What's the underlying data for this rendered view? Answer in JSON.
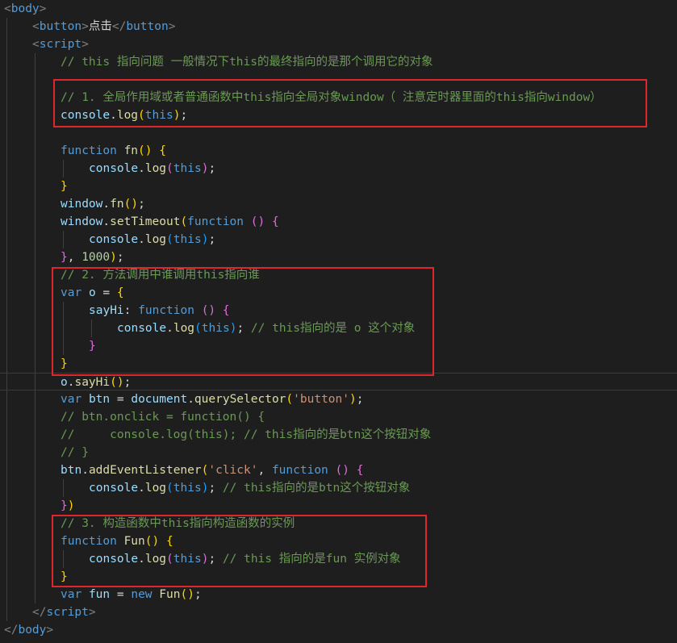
{
  "colors": {
    "background": "#1e1e1e",
    "tag_bracket": "#808080",
    "tag_name": "#569cd6",
    "keyword": "#569cd6",
    "function_name": "#dcdcaa",
    "identifier": "#9cdcfe",
    "string": "#ce9178",
    "number": "#b5cea8",
    "comment": "#6a9955",
    "text": "#d4d4d4",
    "bracket_gold": "#ffd700",
    "bracket_pink": "#da70d6",
    "bracket_blue": "#179fff",
    "highlight_box": "#e0262d"
  },
  "lines": [
    {
      "indent": 0,
      "tokens": [
        {
          "t": "<",
          "c": "tag_bracket"
        },
        {
          "t": "body",
          "c": "tag_name"
        },
        {
          "t": ">",
          "c": "tag_bracket"
        }
      ]
    },
    {
      "indent": 1,
      "tokens": [
        {
          "t": "<",
          "c": "tag_bracket"
        },
        {
          "t": "button",
          "c": "tag_name"
        },
        {
          "t": ">",
          "c": "tag_bracket"
        },
        {
          "t": "点击",
          "c": "text"
        },
        {
          "t": "</",
          "c": "tag_bracket"
        },
        {
          "t": "button",
          "c": "tag_name"
        },
        {
          "t": ">",
          "c": "tag_bracket"
        }
      ]
    },
    {
      "indent": 1,
      "tokens": [
        {
          "t": "<",
          "c": "tag_bracket"
        },
        {
          "t": "script",
          "c": "tag_name"
        },
        {
          "t": ">",
          "c": "tag_bracket"
        }
      ]
    },
    {
      "indent": 2,
      "tokens": [
        {
          "t": "// this 指向问题 一般情况下this的最终指向的是那个调用它的对象",
          "c": "comment"
        }
      ]
    },
    {
      "indent": 0,
      "tokens": []
    },
    {
      "indent": 2,
      "tokens": [
        {
          "t": "// 1. 全局作用域或者普通函数中this指向全局对象window（ 注意定时器里面的this指向window）",
          "c": "comment"
        }
      ]
    },
    {
      "indent": 2,
      "tokens": [
        {
          "t": "console",
          "c": "identifier"
        },
        {
          "t": ".",
          "c": "text"
        },
        {
          "t": "log",
          "c": "function_name"
        },
        {
          "t": "(",
          "c": "bracket_gold"
        },
        {
          "t": "this",
          "c": "keyword"
        },
        {
          "t": ")",
          "c": "bracket_gold"
        },
        {
          "t": ";",
          "c": "text"
        }
      ]
    },
    {
      "indent": 0,
      "tokens": []
    },
    {
      "indent": 2,
      "tokens": [
        {
          "t": "function",
          "c": "keyword"
        },
        {
          "t": " ",
          "c": "text"
        },
        {
          "t": "fn",
          "c": "function_name"
        },
        {
          "t": "()",
          "c": "bracket_gold"
        },
        {
          "t": " ",
          "c": "text"
        },
        {
          "t": "{",
          "c": "bracket_gold"
        }
      ]
    },
    {
      "indent": 3,
      "tokens": [
        {
          "t": "console",
          "c": "identifier"
        },
        {
          "t": ".",
          "c": "text"
        },
        {
          "t": "log",
          "c": "function_name"
        },
        {
          "t": "(",
          "c": "bracket_pink"
        },
        {
          "t": "this",
          "c": "keyword"
        },
        {
          "t": ")",
          "c": "bracket_pink"
        },
        {
          "t": ";",
          "c": "text"
        }
      ]
    },
    {
      "indent": 2,
      "tokens": [
        {
          "t": "}",
          "c": "bracket_gold"
        }
      ]
    },
    {
      "indent": 2,
      "tokens": [
        {
          "t": "window",
          "c": "identifier"
        },
        {
          "t": ".",
          "c": "text"
        },
        {
          "t": "fn",
          "c": "function_name"
        },
        {
          "t": "()",
          "c": "bracket_gold"
        },
        {
          "t": ";",
          "c": "text"
        }
      ]
    },
    {
      "indent": 2,
      "tokens": [
        {
          "t": "window",
          "c": "identifier"
        },
        {
          "t": ".",
          "c": "text"
        },
        {
          "t": "setTimeout",
          "c": "function_name"
        },
        {
          "t": "(",
          "c": "bracket_gold"
        },
        {
          "t": "function",
          "c": "keyword"
        },
        {
          "t": " ",
          "c": "text"
        },
        {
          "t": "()",
          "c": "bracket_pink"
        },
        {
          "t": " ",
          "c": "text"
        },
        {
          "t": "{",
          "c": "bracket_pink"
        }
      ]
    },
    {
      "indent": 3,
      "tokens": [
        {
          "t": "console",
          "c": "identifier"
        },
        {
          "t": ".",
          "c": "text"
        },
        {
          "t": "log",
          "c": "function_name"
        },
        {
          "t": "(",
          "c": "bracket_blue"
        },
        {
          "t": "this",
          "c": "keyword"
        },
        {
          "t": ")",
          "c": "bracket_blue"
        },
        {
          "t": ";",
          "c": "text"
        }
      ]
    },
    {
      "indent": 2,
      "tokens": [
        {
          "t": "}",
          "c": "bracket_pink"
        },
        {
          "t": ", ",
          "c": "text"
        },
        {
          "t": "1000",
          "c": "number"
        },
        {
          "t": ")",
          "c": "bracket_gold"
        },
        {
          "t": ";",
          "c": "text"
        }
      ]
    },
    {
      "indent": 2,
      "tokens": [
        {
          "t": "// 2. 方法调用中谁调用this指向谁",
          "c": "comment"
        }
      ]
    },
    {
      "indent": 2,
      "tokens": [
        {
          "t": "var",
          "c": "keyword"
        },
        {
          "t": " ",
          "c": "text"
        },
        {
          "t": "o",
          "c": "identifier"
        },
        {
          "t": " = ",
          "c": "text"
        },
        {
          "t": "{",
          "c": "bracket_gold"
        }
      ]
    },
    {
      "indent": 3,
      "tokens": [
        {
          "t": "sayHi",
          "c": "identifier"
        },
        {
          "t": ": ",
          "c": "text"
        },
        {
          "t": "function",
          "c": "keyword"
        },
        {
          "t": " ",
          "c": "text"
        },
        {
          "t": "()",
          "c": "bracket_pink"
        },
        {
          "t": " ",
          "c": "text"
        },
        {
          "t": "{",
          "c": "bracket_pink"
        }
      ]
    },
    {
      "indent": 4,
      "tokens": [
        {
          "t": "console",
          "c": "identifier"
        },
        {
          "t": ".",
          "c": "text"
        },
        {
          "t": "log",
          "c": "function_name"
        },
        {
          "t": "(",
          "c": "bracket_blue"
        },
        {
          "t": "this",
          "c": "keyword"
        },
        {
          "t": ")",
          "c": "bracket_blue"
        },
        {
          "t": "; ",
          "c": "text"
        },
        {
          "t": "// this指向的是 o 这个对象",
          "c": "comment"
        }
      ]
    },
    {
      "indent": 3,
      "tokens": [
        {
          "t": "}",
          "c": "bracket_pink"
        }
      ]
    },
    {
      "indent": 2,
      "tokens": [
        {
          "t": "}",
          "c": "bracket_gold"
        }
      ]
    },
    {
      "indent": 2,
      "current": true,
      "tokens": [
        {
          "t": "o",
          "c": "identifier"
        },
        {
          "t": ".",
          "c": "text"
        },
        {
          "t": "sayHi",
          "c": "function_name"
        },
        {
          "t": "()",
          "c": "bracket_gold"
        },
        {
          "t": ";",
          "c": "text"
        }
      ]
    },
    {
      "indent": 2,
      "tokens": [
        {
          "t": "var",
          "c": "keyword"
        },
        {
          "t": " ",
          "c": "text"
        },
        {
          "t": "btn",
          "c": "identifier"
        },
        {
          "t": " = ",
          "c": "text"
        },
        {
          "t": "document",
          "c": "identifier"
        },
        {
          "t": ".",
          "c": "text"
        },
        {
          "t": "querySelector",
          "c": "function_name"
        },
        {
          "t": "(",
          "c": "bracket_gold"
        },
        {
          "t": "'button'",
          "c": "string"
        },
        {
          "t": ")",
          "c": "bracket_gold"
        },
        {
          "t": ";",
          "c": "text"
        }
      ]
    },
    {
      "indent": 2,
      "tokens": [
        {
          "t": "// btn.onclick = function() {",
          "c": "comment"
        }
      ]
    },
    {
      "indent": 2,
      "tokens": [
        {
          "t": "//     console.log(this); // this指向的是btn这个按钮对象",
          "c": "comment"
        }
      ]
    },
    {
      "indent": 2,
      "tokens": [
        {
          "t": "// }",
          "c": "comment"
        }
      ]
    },
    {
      "indent": 2,
      "tokens": [
        {
          "t": "btn",
          "c": "identifier"
        },
        {
          "t": ".",
          "c": "text"
        },
        {
          "t": "addEventListener",
          "c": "function_name"
        },
        {
          "t": "(",
          "c": "bracket_gold"
        },
        {
          "t": "'click'",
          "c": "string"
        },
        {
          "t": ", ",
          "c": "text"
        },
        {
          "t": "function",
          "c": "keyword"
        },
        {
          "t": " ",
          "c": "text"
        },
        {
          "t": "()",
          "c": "bracket_pink"
        },
        {
          "t": " ",
          "c": "text"
        },
        {
          "t": "{",
          "c": "bracket_pink"
        }
      ]
    },
    {
      "indent": 3,
      "tokens": [
        {
          "t": "console",
          "c": "identifier"
        },
        {
          "t": ".",
          "c": "text"
        },
        {
          "t": "log",
          "c": "function_name"
        },
        {
          "t": "(",
          "c": "bracket_blue"
        },
        {
          "t": "this",
          "c": "keyword"
        },
        {
          "t": ")",
          "c": "bracket_blue"
        },
        {
          "t": "; ",
          "c": "text"
        },
        {
          "t": "// this指向的是btn这个按钮对象",
          "c": "comment"
        }
      ]
    },
    {
      "indent": 2,
      "tokens": [
        {
          "t": "}",
          "c": "bracket_pink"
        },
        {
          "t": ")",
          "c": "bracket_gold"
        }
      ]
    },
    {
      "indent": 2,
      "tokens": [
        {
          "t": "// 3. 构造函数中this指向构造函数的实例",
          "c": "comment"
        }
      ]
    },
    {
      "indent": 2,
      "tokens": [
        {
          "t": "function",
          "c": "keyword"
        },
        {
          "t": " ",
          "c": "text"
        },
        {
          "t": "Fun",
          "c": "function_name"
        },
        {
          "t": "()",
          "c": "bracket_gold"
        },
        {
          "t": " ",
          "c": "text"
        },
        {
          "t": "{",
          "c": "bracket_gold"
        }
      ]
    },
    {
      "indent": 3,
      "tokens": [
        {
          "t": "console",
          "c": "identifier"
        },
        {
          "t": ".",
          "c": "text"
        },
        {
          "t": "log",
          "c": "function_name"
        },
        {
          "t": "(",
          "c": "bracket_pink"
        },
        {
          "t": "this",
          "c": "keyword"
        },
        {
          "t": ")",
          "c": "bracket_pink"
        },
        {
          "t": "; ",
          "c": "text"
        },
        {
          "t": "// this 指向的是fun 实例对象",
          "c": "comment"
        }
      ]
    },
    {
      "indent": 2,
      "tokens": [
        {
          "t": "}",
          "c": "bracket_gold"
        }
      ]
    },
    {
      "indent": 2,
      "tokens": [
        {
          "t": "var",
          "c": "keyword"
        },
        {
          "t": " ",
          "c": "text"
        },
        {
          "t": "fun",
          "c": "identifier"
        },
        {
          "t": " = ",
          "c": "text"
        },
        {
          "t": "new",
          "c": "keyword"
        },
        {
          "t": " ",
          "c": "text"
        },
        {
          "t": "Fun",
          "c": "function_name"
        },
        {
          "t": "()",
          "c": "bracket_gold"
        },
        {
          "t": ";",
          "c": "text"
        }
      ]
    },
    {
      "indent": 1,
      "tokens": [
        {
          "t": "</",
          "c": "tag_bracket"
        },
        {
          "t": "script",
          "c": "tag_name"
        },
        {
          "t": ">",
          "c": "tag_bracket"
        }
      ]
    },
    {
      "indent": 0,
      "tokens": [
        {
          "t": "</",
          "c": "tag_bracket"
        },
        {
          "t": "body",
          "c": "tag_name"
        },
        {
          "t": ">",
          "c": "tag_bracket"
        }
      ]
    }
  ]
}
